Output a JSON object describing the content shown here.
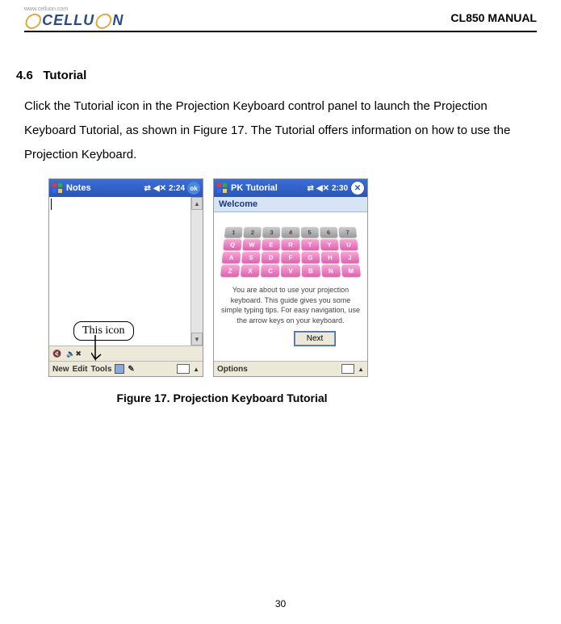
{
  "header": {
    "url": "www.celluon.com",
    "brand": "CELLU",
    "brand2": "N",
    "title": "CL850 MANUAL"
  },
  "section": {
    "number": "4.6",
    "title": "Tutorial",
    "body": "Click the Tutorial icon in the Projection Keyboard control panel to launch the Projection Keyboard Tutorial, as shown in Figure 17. The Tutorial offers information on how to use the Projection Keyboard."
  },
  "screenshotA": {
    "app": "Notes",
    "time": "2:24",
    "ok": "ok",
    "callout": "This icon",
    "menu": {
      "new": "New",
      "edit": "Edit",
      "tools": "Tools"
    }
  },
  "screenshotB": {
    "app": "PK Tutorial",
    "time": "2:30",
    "subheader": "Welcome",
    "body": "You are about to use your projection keyboard. This guide gives you some simple typing tips. For easy navigation, use the arrow keys on your keyboard.",
    "next": "Next",
    "options": "Options"
  },
  "keys": {
    "row1": [
      "1",
      "2",
      "3",
      "4",
      "5",
      "6",
      "7"
    ],
    "row2": [
      "Q",
      "W",
      "E",
      "R",
      "T",
      "Y",
      "U"
    ],
    "row3": [
      "A",
      "S",
      "D",
      "F",
      "G",
      "H",
      "J"
    ],
    "row4": [
      "Z",
      "X",
      "C",
      "V",
      "B",
      "N",
      "M"
    ]
  },
  "figure": {
    "caption": "Figure 17. Projection Keyboard Tutorial"
  },
  "pageNumber": "30"
}
